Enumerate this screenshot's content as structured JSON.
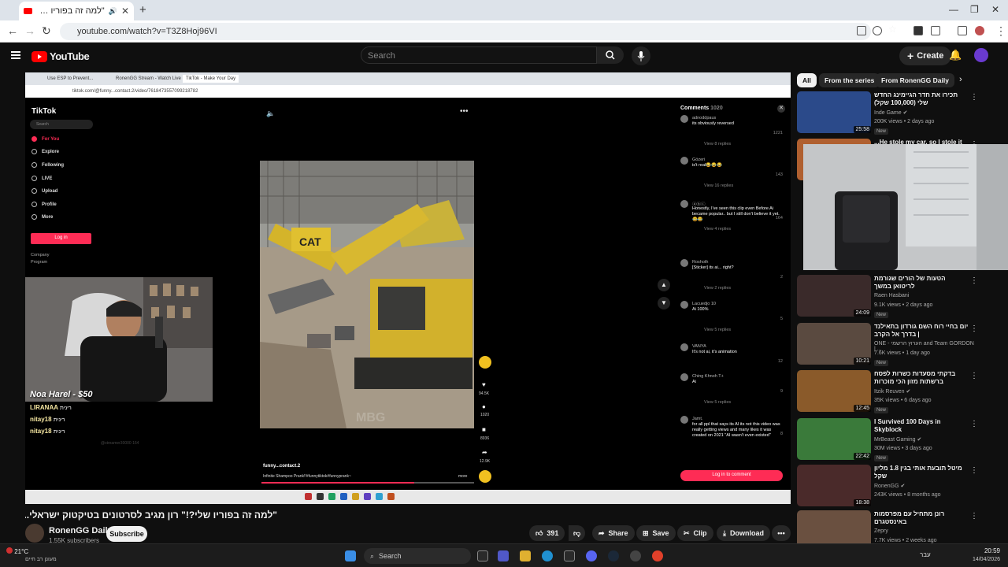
{
  "browser": {
    "tab_title": "\"למה זה בפוריו שלי?!\" רון",
    "url": "youtube.com/watch?v=T3Z8Hoj96VI"
  },
  "youtube": {
    "logo_text": "YouTube",
    "search_placeholder": "Search",
    "create_label": "Create"
  },
  "video": {
    "inner_browser_tabs": [
      "Use ESP to Prevent...",
      "RonenGG Stream - Watch Live",
      "TikTok - Make Your Day"
    ],
    "inner_url": "tiktok.com/@funny...contact.2/video/7618473557099218782",
    "tiktok": {
      "logo": "TikTok",
      "search": "Search",
      "nav": [
        "For You",
        "Explore",
        "Following",
        "LIVE",
        "Upload",
        "Profile",
        "More"
      ],
      "login": "Log in",
      "footer": [
        "Company",
        "Program"
      ],
      "author": "funny...contact.2",
      "caption": "Infinite Shampoo Prank!!#funnytiktok#funnyprank~",
      "more": "more",
      "watermark": "MBG",
      "cam_watermark": "@streamer30000 164",
      "actions": [
        "94.5K",
        "1020",
        "8936",
        "12.9K"
      ]
    },
    "donation": {
      "header": "Noa Harel - $50",
      "lines": [
        {
          "name": "LIRANAA",
          "action": "רינית"
        },
        {
          "name": "nitay18",
          "action": "רינית"
        },
        {
          "name": "nitay18",
          "action": "רינית"
        }
      ]
    },
    "comments": {
      "title": "Comments",
      "count": "1020",
      "items": [
        {
          "user": "adnoddpaus",
          "text": "its obviously reversed",
          "likes": "1221",
          "replies": "View 8 replies"
        },
        {
          "user": "Gözeri",
          "text": "is't real😂😂😂",
          "likes": "143",
          "replies": "View 16 replies"
        },
        {
          "user": "ⓐⓑⓒ",
          "text": "Honestly, I've seen this clip even Before Ai became popular.. but I still don't believe it yet. 😂😂",
          "likes": "164",
          "replies": "View 4 replies"
        },
        {
          "user": "Roshoth",
          "text": "[Sticker] its ai... right?",
          "likes": "2",
          "replies": "View 2 replies"
        },
        {
          "user": "Lacuedjo 10",
          "text": "Ai 100%",
          "likes": "5",
          "replies": "View 5 replies"
        },
        {
          "user": "VANYA",
          "text": "It's not ai, it's animation",
          "likes": "12",
          "replies": ""
        },
        {
          "user": "Ching Khnoh T+",
          "text": "Ai",
          "likes": "9",
          "replies": "View 5 replies"
        },
        {
          "user": "Jamt.",
          "text": "for all ppl that says its AI its not this video was really getting views and many likes it was created on 2021 \"AI wasn't even existed\"",
          "likes": "8",
          "replies": ""
        }
      ],
      "login": "Log in to comment"
    }
  },
  "watch": {
    "title": "\"למה זה בפוריו שלי?!\" רון מגיב לסרטונים בטיקטוק ישראלי...",
    "channel": "RonenGG Daily",
    "subscribers": "1.55K subscribers",
    "subscribe": "Subscribe",
    "likes": "391",
    "share": "Share",
    "save": "Save",
    "clip": "Clip",
    "download": "Download"
  },
  "sidebar": {
    "chips": [
      "All",
      "From the series",
      "From RonenGG Daily"
    ],
    "recs": [
      {
        "title": "תכירו את חדר הגיימינג החדש שלי (100,000 שקל)",
        "channel": "Inde Game ✔",
        "views": "200K views • 2 days ago",
        "dur": "25:58",
        "new": "New",
        "color": "#2b4a8a"
      },
      {
        "title": "He stole my car, so I stole it...",
        "channel": "",
        "views": "",
        "dur": "",
        "new": "",
        "color": "#b06030"
      },
      {
        "title": "הטעות של הורים שגורמת לריטואן במשך",
        "channel": "Raen Hasbani",
        "views": "9.1K views • 2 days ago",
        "dur": "24:09",
        "new": "New",
        "color": "#3a2a2a"
      },
      {
        "title": "יום בחיי רוח השם גורדון בתאילנד | בדרך אל הקרב",
        "channel": "ONE - הערוץ הרשמי and Team GORDON | ...",
        "views": "7.6K views • 1 day ago",
        "dur": "10:21",
        "new": "New",
        "color": "#5a4a40"
      },
      {
        "title": "בדקתי מסעדות כשרות לפסח ברשתות מזון הכי מוכרות בישראל!",
        "channel": "Itzik Reuven ✔",
        "views": "35K views • 6 days ago",
        "dur": "12:45",
        "new": "New",
        "color": "#8a5a2a"
      },
      {
        "title": "I Survived 100 Days in Skyblock",
        "channel": "MrBeast Gaming ✔",
        "views": "30M views • 3 days ago",
        "dur": "22:42",
        "new": "New",
        "color": "#3a7a3a"
      },
      {
        "title": "מיטל תובעת אותי בגין 1.8 מליון שקל",
        "channel": "RonenGG ✔",
        "views": "243K views • 8 months ago",
        "dur": "18:38",
        "new": "",
        "color": "#4a2a2a"
      },
      {
        "title": "רונן מתחיל עם מפרסמות באינסטגרם",
        "channel": "Zepry",
        "views": "7.7K views • 2 weeks ago",
        "dur": "",
        "new": "",
        "color": "#6a5040"
      }
    ]
  },
  "taskbar": {
    "weather_temp": "21°C",
    "weather_text": "מעונן רב חיים",
    "search": "Search",
    "lang": "עבר",
    "time": "20:59",
    "date": "14/04/2026"
  }
}
